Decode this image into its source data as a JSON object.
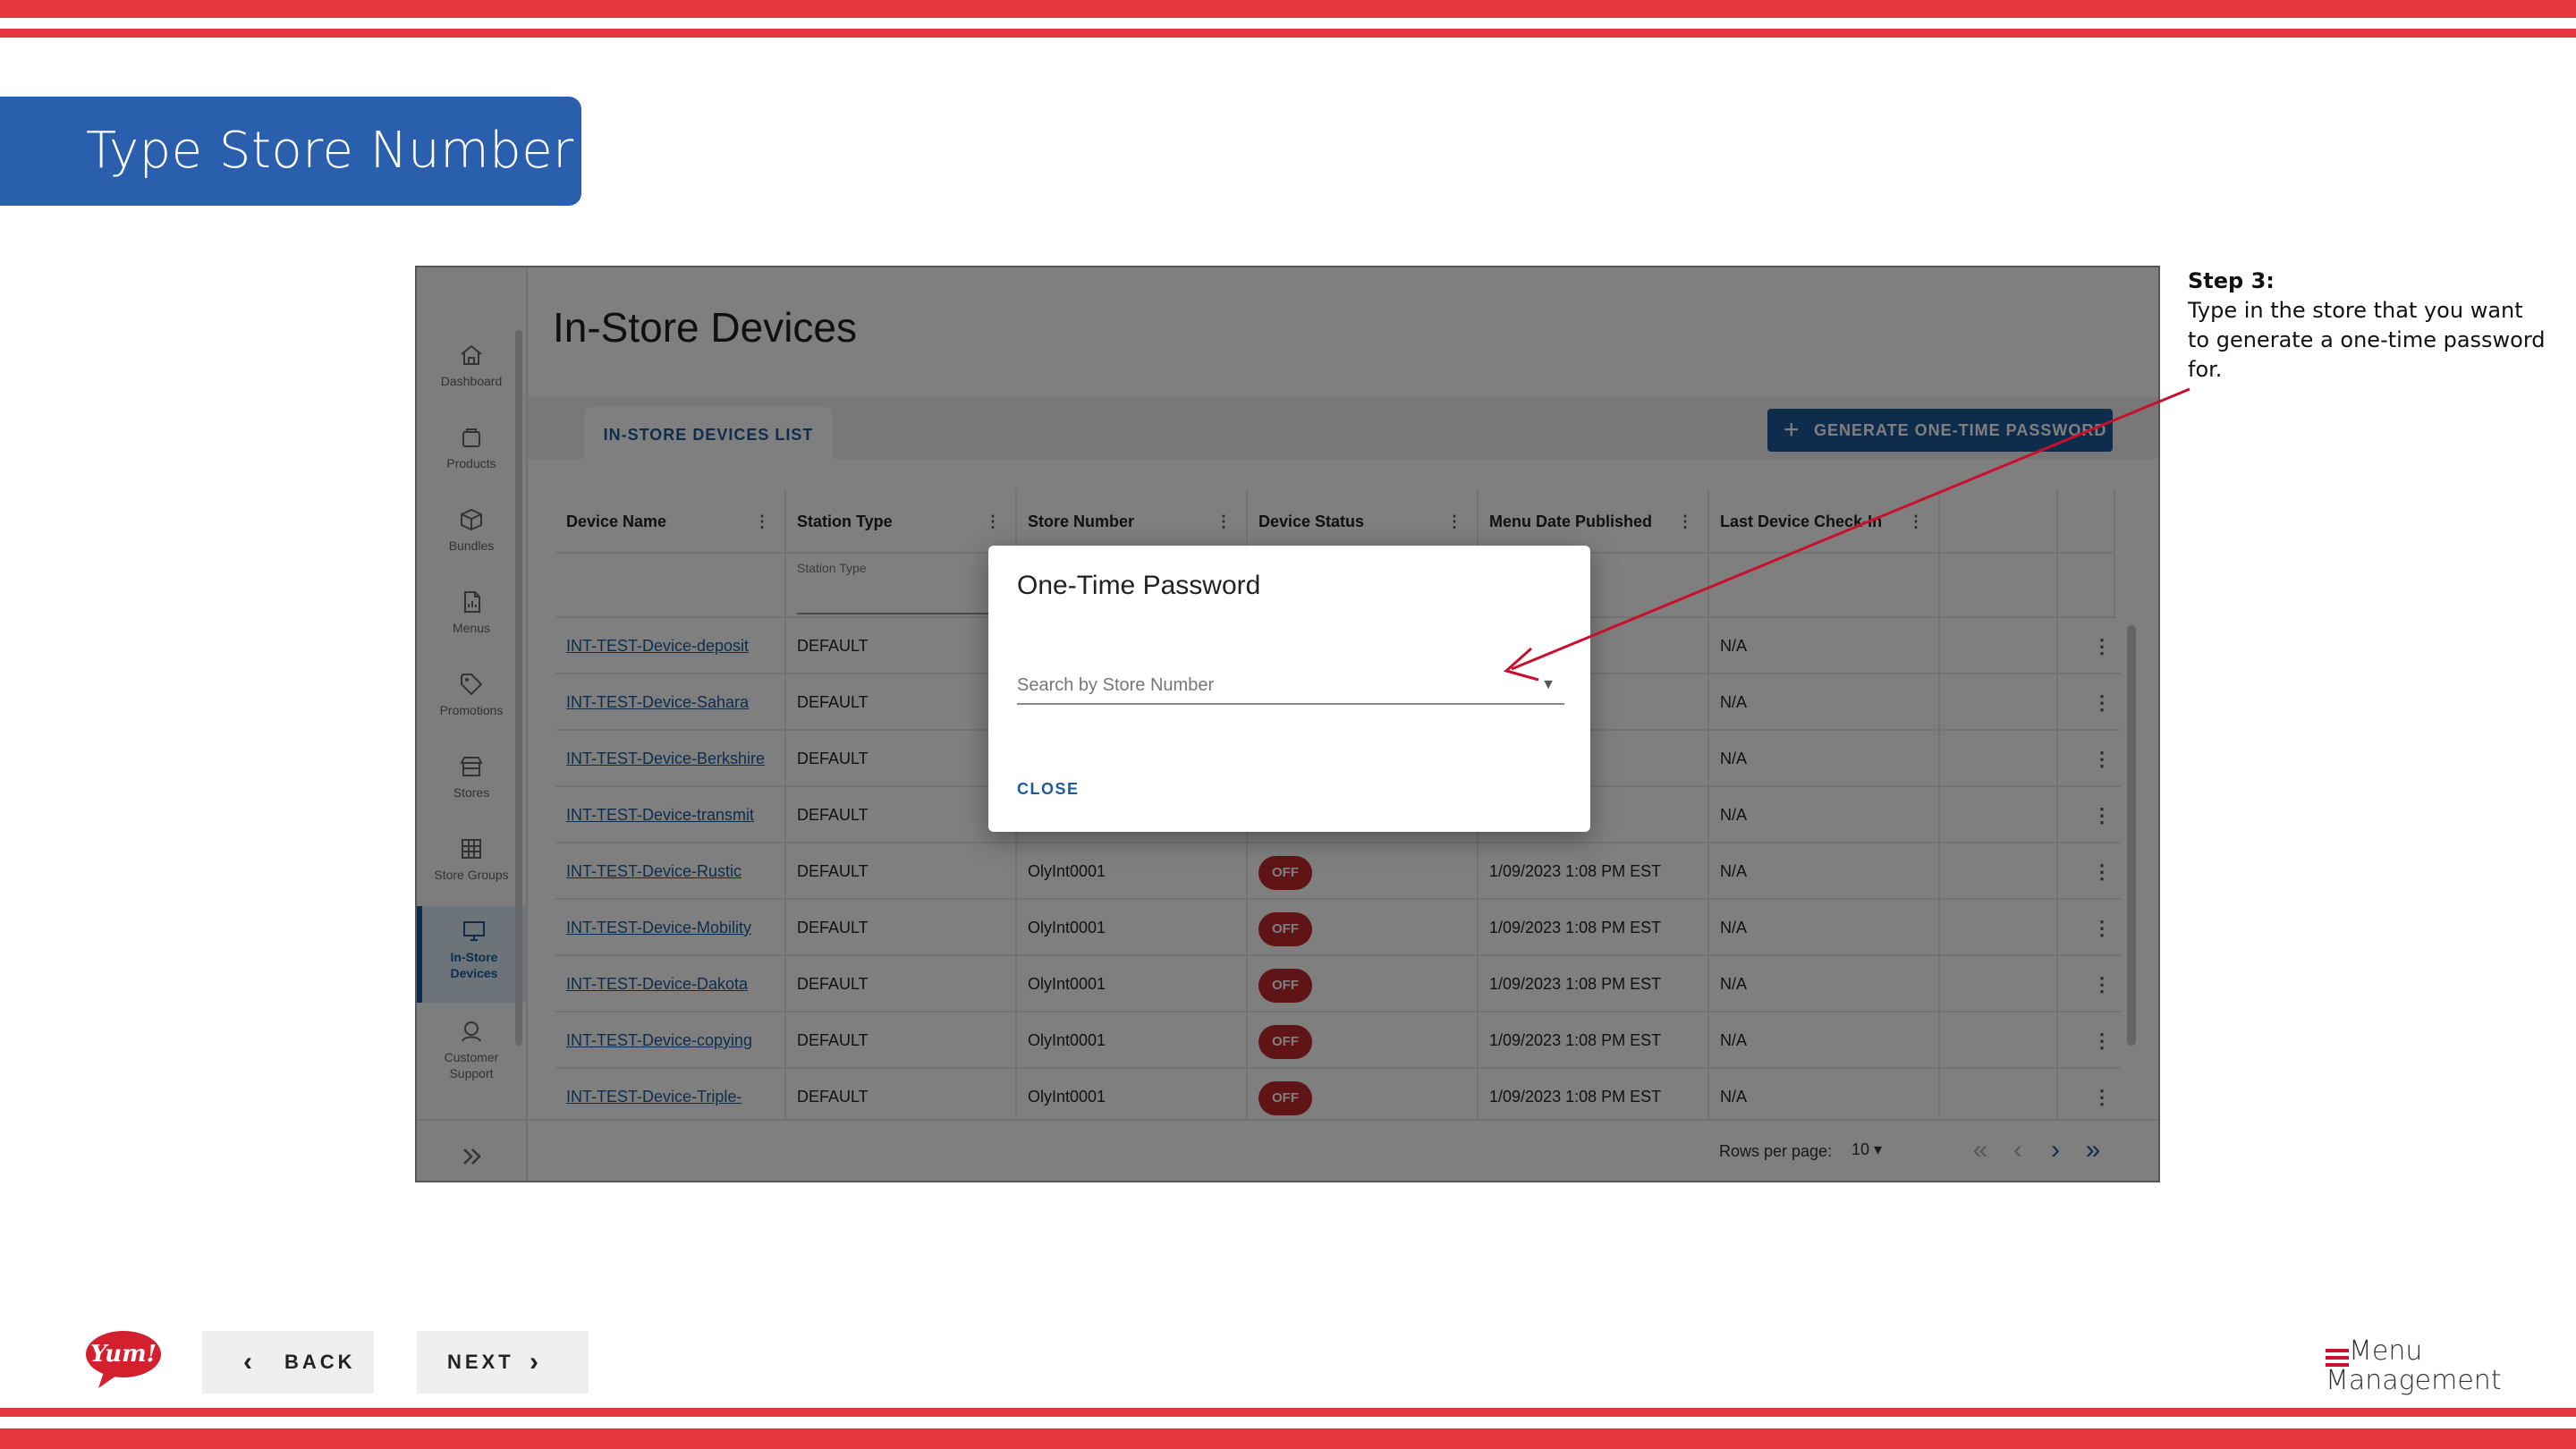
{
  "banner": {
    "title": "Type Store Number"
  },
  "step_note": {
    "title": "Step 3:",
    "text": "Type in the store that you want to generate a one-time password for."
  },
  "app": {
    "page_title": "In-Store Devices",
    "tab_label": "IN-STORE DEVICES LIST",
    "generate_button": "GENERATE ONE-TIME PASSWORD",
    "sidebar": [
      {
        "label": "Dashboard",
        "icon": "home-icon"
      },
      {
        "label": "Products",
        "icon": "bag-icon"
      },
      {
        "label": "Bundles",
        "icon": "box-icon"
      },
      {
        "label": "Menus",
        "icon": "document-icon"
      },
      {
        "label": "Promotions",
        "icon": "tag-icon"
      },
      {
        "label": "Stores",
        "icon": "store-icon"
      },
      {
        "label": "Store Groups",
        "icon": "grid-icon"
      },
      {
        "label": "In-Store",
        "label2": "Devices",
        "icon": "monitor-icon",
        "active": true
      },
      {
        "label": "Customer",
        "label2": "Support",
        "icon": "support-icon"
      }
    ],
    "columns": [
      "Device Name",
      "Station Type",
      "Store Number",
      "Device Status",
      "Menu Date Published",
      "Last Device Check-In"
    ],
    "filter_placeholder": "Station Type",
    "rows": [
      {
        "device": "INT-TEST-Device-deposit",
        "station": "DEFAULT",
        "store": "",
        "status": "",
        "menu_date": "",
        "checkin": "N/A"
      },
      {
        "device": "INT-TEST-Device-Sahara",
        "station": "DEFAULT",
        "store": "",
        "status": "",
        "menu_date": "08 PM EST",
        "checkin": "N/A"
      },
      {
        "device": "INT-TEST-Device-Berkshire",
        "station": "DEFAULT",
        "store": "",
        "status": "",
        "menu_date": "08 PM EST",
        "checkin": "N/A"
      },
      {
        "device": "INT-TEST-Device-transmit",
        "station": "DEFAULT",
        "store": "",
        "status": "",
        "menu_date": "08 PM EST",
        "checkin": "N/A"
      },
      {
        "device": "INT-TEST-Device-Rustic",
        "station": "DEFAULT",
        "store": "OlyInt0001",
        "status": "OFF",
        "menu_date": "1/09/2023 1:08 PM EST",
        "checkin": "N/A"
      },
      {
        "device": "INT-TEST-Device-Mobility",
        "station": "DEFAULT",
        "store": "OlyInt0001",
        "status": "OFF",
        "menu_date": "1/09/2023 1:08 PM EST",
        "checkin": "N/A"
      },
      {
        "device": "INT-TEST-Device-Dakota",
        "station": "DEFAULT",
        "store": "OlyInt0001",
        "status": "OFF",
        "menu_date": "1/09/2023 1:08 PM EST",
        "checkin": "N/A"
      },
      {
        "device": "INT-TEST-Device-copying",
        "station": "DEFAULT",
        "store": "OlyInt0001",
        "status": "OFF",
        "menu_date": "1/09/2023 1:08 PM EST",
        "checkin": "N/A"
      },
      {
        "device": "INT-TEST-Device-Triple-",
        "station": "DEFAULT",
        "store": "OlyInt0001",
        "status": "OFF",
        "menu_date": "1/09/2023 1:08 PM EST",
        "checkin": "N/A"
      }
    ],
    "pagination": {
      "rows_per_page_label": "Rows per page:",
      "rows_per_page_value": "10"
    }
  },
  "dialog": {
    "title": "One-Time Password",
    "search_placeholder": "Search by Store Number",
    "close_label": "CLOSE"
  },
  "nav": {
    "back_label": "BACK",
    "next_label": "NEXT"
  },
  "logos": {
    "yum": "Yum!",
    "menu_management_1": "Menu",
    "menu_management_2": "Management"
  },
  "colors": {
    "accent_red": "#e5363f",
    "banner_blue": "#2a5fae",
    "app_blue": "#1d5b98",
    "badge_red": "#c0282c"
  }
}
